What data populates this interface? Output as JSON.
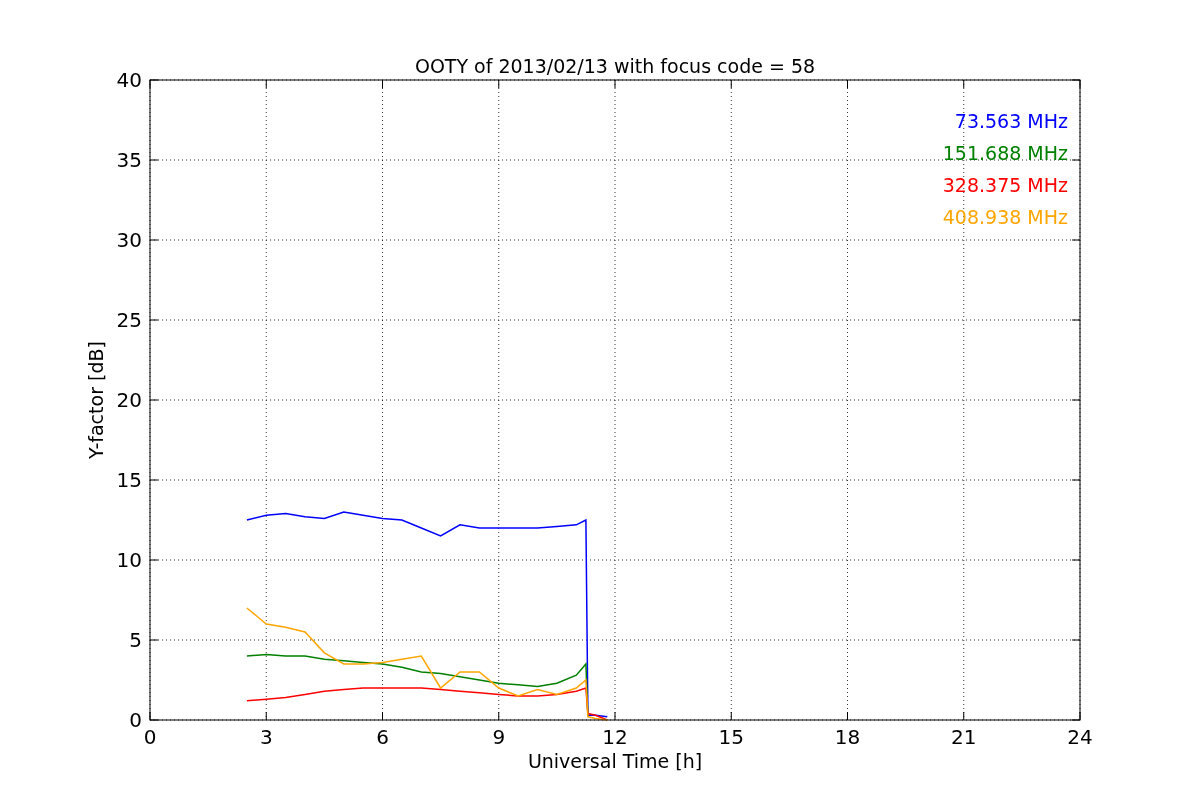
{
  "chart_data": {
    "type": "line",
    "title": "OOTY of 2013/02/13 with focus code = 58",
    "xlabel": "Universal Time [h]",
    "ylabel": "Y-factor [dB]",
    "x": [
      2.5,
      3,
      3.5,
      4,
      4.5,
      5,
      5.5,
      6,
      6.5,
      7,
      7.5,
      8,
      8.5,
      9,
      9.5,
      10,
      10.5,
      11,
      11.25,
      11.3,
      11.5,
      11.8
    ],
    "series": [
      {
        "name": "73.563 MHz",
        "color": "#0000ff",
        "values": [
          12.5,
          12.8,
          12.9,
          12.7,
          12.6,
          13,
          12.8,
          12.6,
          12.5,
          12,
          11.5,
          12.2,
          12,
          12,
          12,
          12,
          12.1,
          12.2,
          12.5,
          0.3,
          0.3,
          0.2
        ]
      },
      {
        "name": "151.688 MHz",
        "color": "#008000",
        "values": [
          4,
          4.1,
          4,
          4,
          3.8,
          3.7,
          3.6,
          3.5,
          3.3,
          3,
          2.9,
          2.7,
          2.5,
          2.3,
          2.2,
          2.1,
          2.3,
          2.8,
          3.5,
          0.2,
          null,
          null
        ]
      },
      {
        "name": "328.375 MHz",
        "color": "#ff0000",
        "values": [
          1.2,
          1.3,
          1.4,
          1.6,
          1.8,
          1.9,
          2,
          2,
          2,
          2,
          1.9,
          1.8,
          1.7,
          1.6,
          1.5,
          1.5,
          1.6,
          1.8,
          2,
          0.4,
          0.3,
          0
        ]
      },
      {
        "name": "408.938 MHz",
        "color": "#ffa500",
        "values": [
          7,
          6,
          5.8,
          5.5,
          4.2,
          3.5,
          3.5,
          3.6,
          3.8,
          4,
          2,
          3,
          3,
          2,
          1.5,
          1.9,
          1.6,
          2,
          2.5,
          0.2,
          0.1,
          0
        ]
      }
    ],
    "xlim": [
      0,
      24
    ],
    "ylim": [
      0,
      40
    ],
    "xticks": [
      0,
      3,
      6,
      9,
      12,
      15,
      18,
      21,
      24
    ],
    "yticks": [
      0,
      5,
      10,
      15,
      20,
      25,
      30,
      35,
      40
    ],
    "grid": true
  }
}
